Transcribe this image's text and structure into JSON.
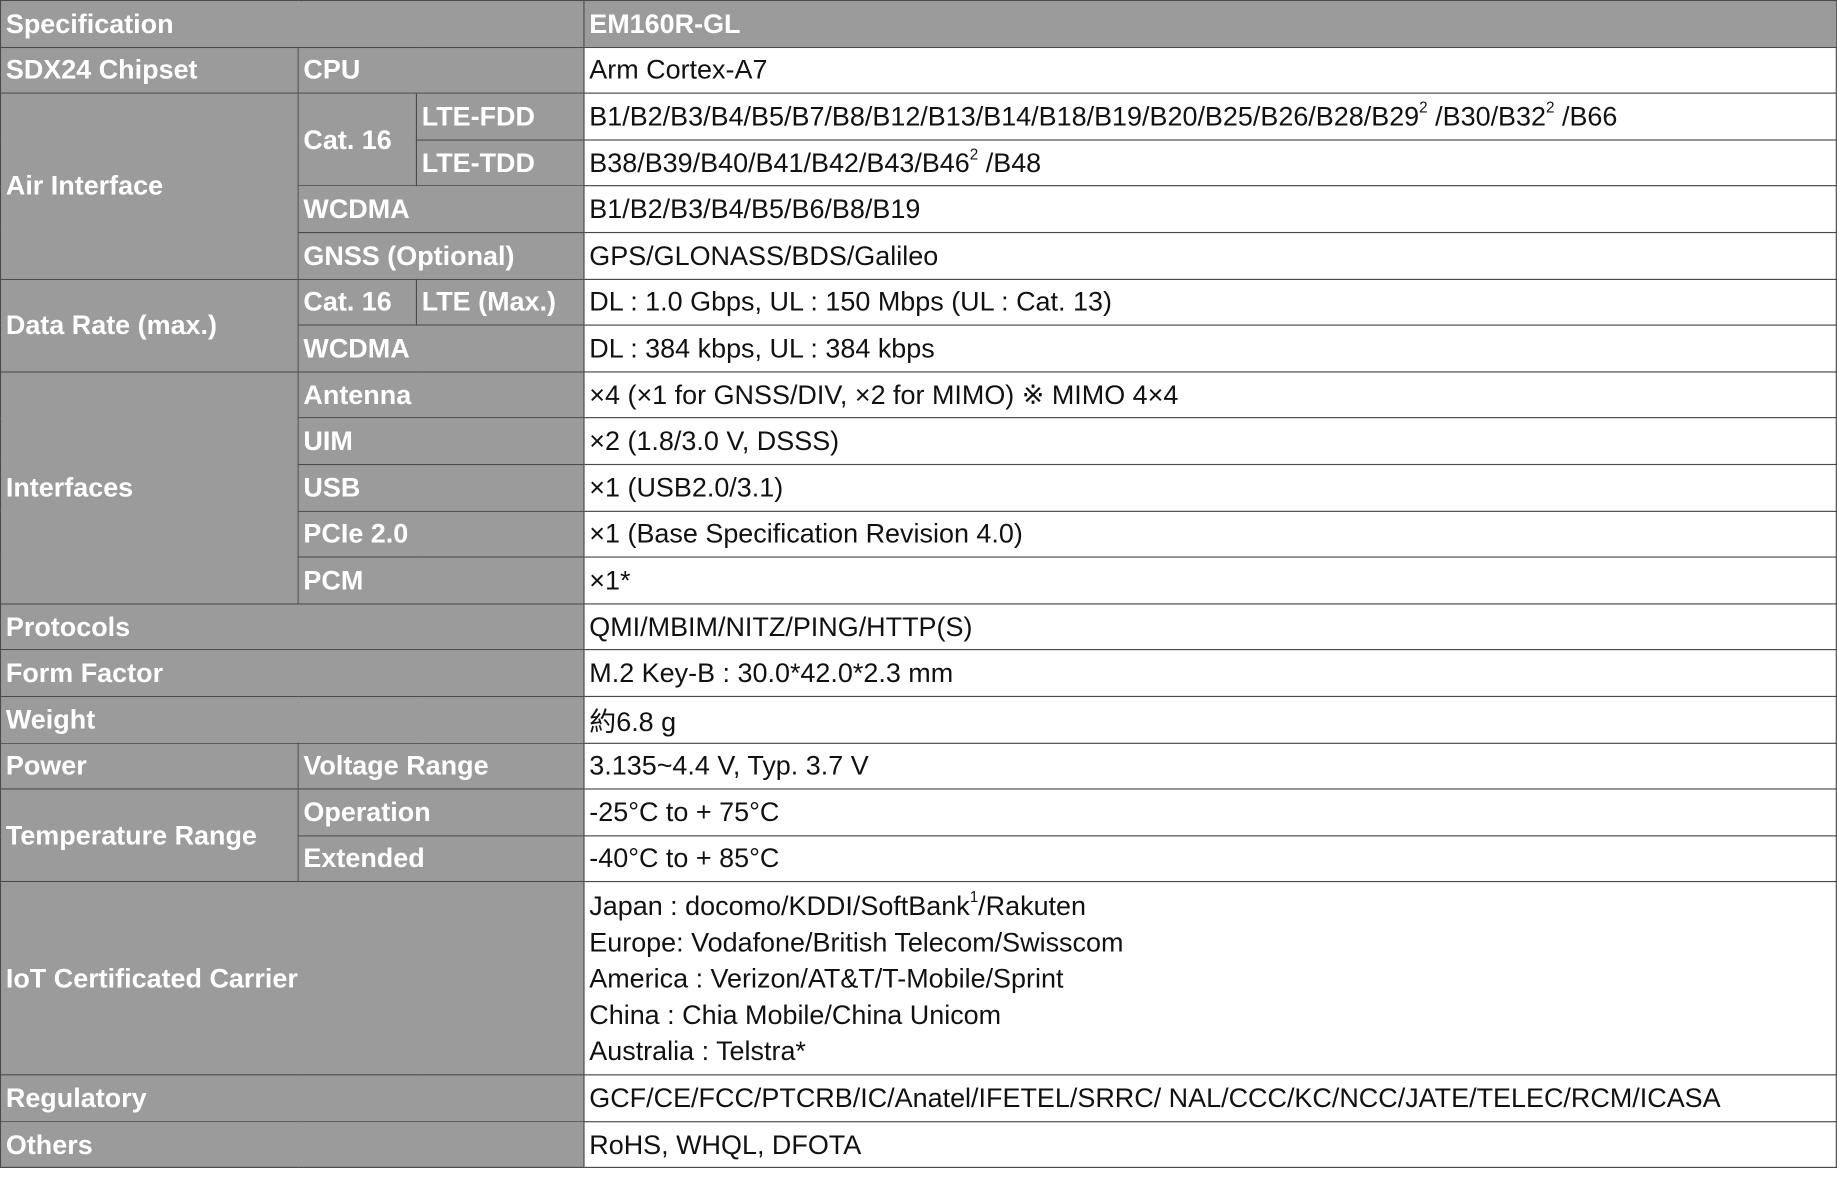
{
  "header": {
    "label": "Specification",
    "model": "EM160R-GL"
  },
  "chipset": {
    "label": "SDX24 Chipset",
    "cpu_label": "CPU",
    "cpu_value": "Arm Cortex-A7"
  },
  "air": {
    "label": "Air Interface",
    "cat_label": "Cat. 16",
    "lte_fdd_label": "LTE-FDD",
    "lte_fdd_value": {
      "a": "B1/B2/B3/B4/B5/B7/B8/B12/B13/B14/B18/B19/B20/B25/B26/B28/B29",
      "sup1": "2",
      "b": " /B30/B32",
      "sup2": "2",
      "c": " /B66"
    },
    "lte_tdd_label": "LTE-TDD",
    "lte_tdd_value": {
      "a": "B38/B39/B40/B41/B42/B43/B46",
      "sup": "2",
      "b": " /B48"
    },
    "wcdma_label": "WCDMA",
    "wcdma_value": "B1/B2/B3/B4/B5/B6/B8/B19",
    "gnss_label": "GNSS (Optional)",
    "gnss_value": "GPS/GLONASS/BDS/Galileo"
  },
  "data_rate": {
    "label": "Data Rate (max.)",
    "cat_label": "Cat. 16",
    "lte_label": "LTE (Max.)",
    "lte_value": "DL : 1.0 Gbps, UL : 150 Mbps  (UL : Cat. 13)",
    "wcdma_label": "WCDMA",
    "wcdma_value": "DL : 384 kbps, UL : 384 kbps"
  },
  "interfaces": {
    "label": "Interfaces",
    "rows": [
      {
        "label": "Antenna",
        "value": "×4 (×1 for GNSS/DIV, ×2 for MIMO)  ※ MIMO 4×4"
      },
      {
        "label": "UIM",
        "value": "×2 (1.8/3.0 V, DSSS)"
      },
      {
        "label": "USB",
        "value": "×1 (USB2.0/3.1)"
      },
      {
        "label": "PCIe 2.0",
        "value": "×1 (Base Specification Revision 4.0)"
      },
      {
        "label": "PCM",
        "value": "×1*"
      }
    ]
  },
  "protocols": {
    "label": "Protocols",
    "value": "QMI/MBIM/NITZ/PING/HTTP(S)"
  },
  "form_factor": {
    "label": "Form Factor",
    "value": "M.2 Key-B : 30.0*42.0*2.3 mm"
  },
  "weight": {
    "label": "Weight",
    "value": "約6.8 g"
  },
  "power": {
    "label": "Power",
    "sub_label": "Voltage Range",
    "value": "3.135~4.4 V, Typ. 3.7 V"
  },
  "temperature": {
    "label": "Temperature Range",
    "operation_label": "Operation",
    "operation_value": "-25°C to + 75°C",
    "extended_label": "Extended",
    "extended_value": "-40°C to + 85°C"
  },
  "carrier": {
    "label": "IoT Certificated Carrier",
    "japan": {
      "a": "Japan : docomo/KDDI/SoftBank",
      "sup": "1",
      "b": "/Rakuten"
    },
    "lines": [
      "Europe: Vodafone/British Telecom/Swisscom",
      "America : Verizon/AT&T/T-Mobile/Sprint",
      "China : Chia Mobile/China Unicom",
      "Australia : Telstra*"
    ]
  },
  "regulatory": {
    "label": "Regulatory",
    "value": "GCF/CE/FCC/PTCRB/IC/Anatel/IFETEL/SRRC/ NAL/CCC/KC/NCC/JATE/TELEC/RCM/ICASA"
  },
  "others": {
    "label": "Others",
    "value": "RoHS, WHQL, DFOTA"
  },
  "colors": {
    "header_bg": "#9b9b9b",
    "header_text": "#ffffff",
    "border": "#4a4a4a"
  }
}
